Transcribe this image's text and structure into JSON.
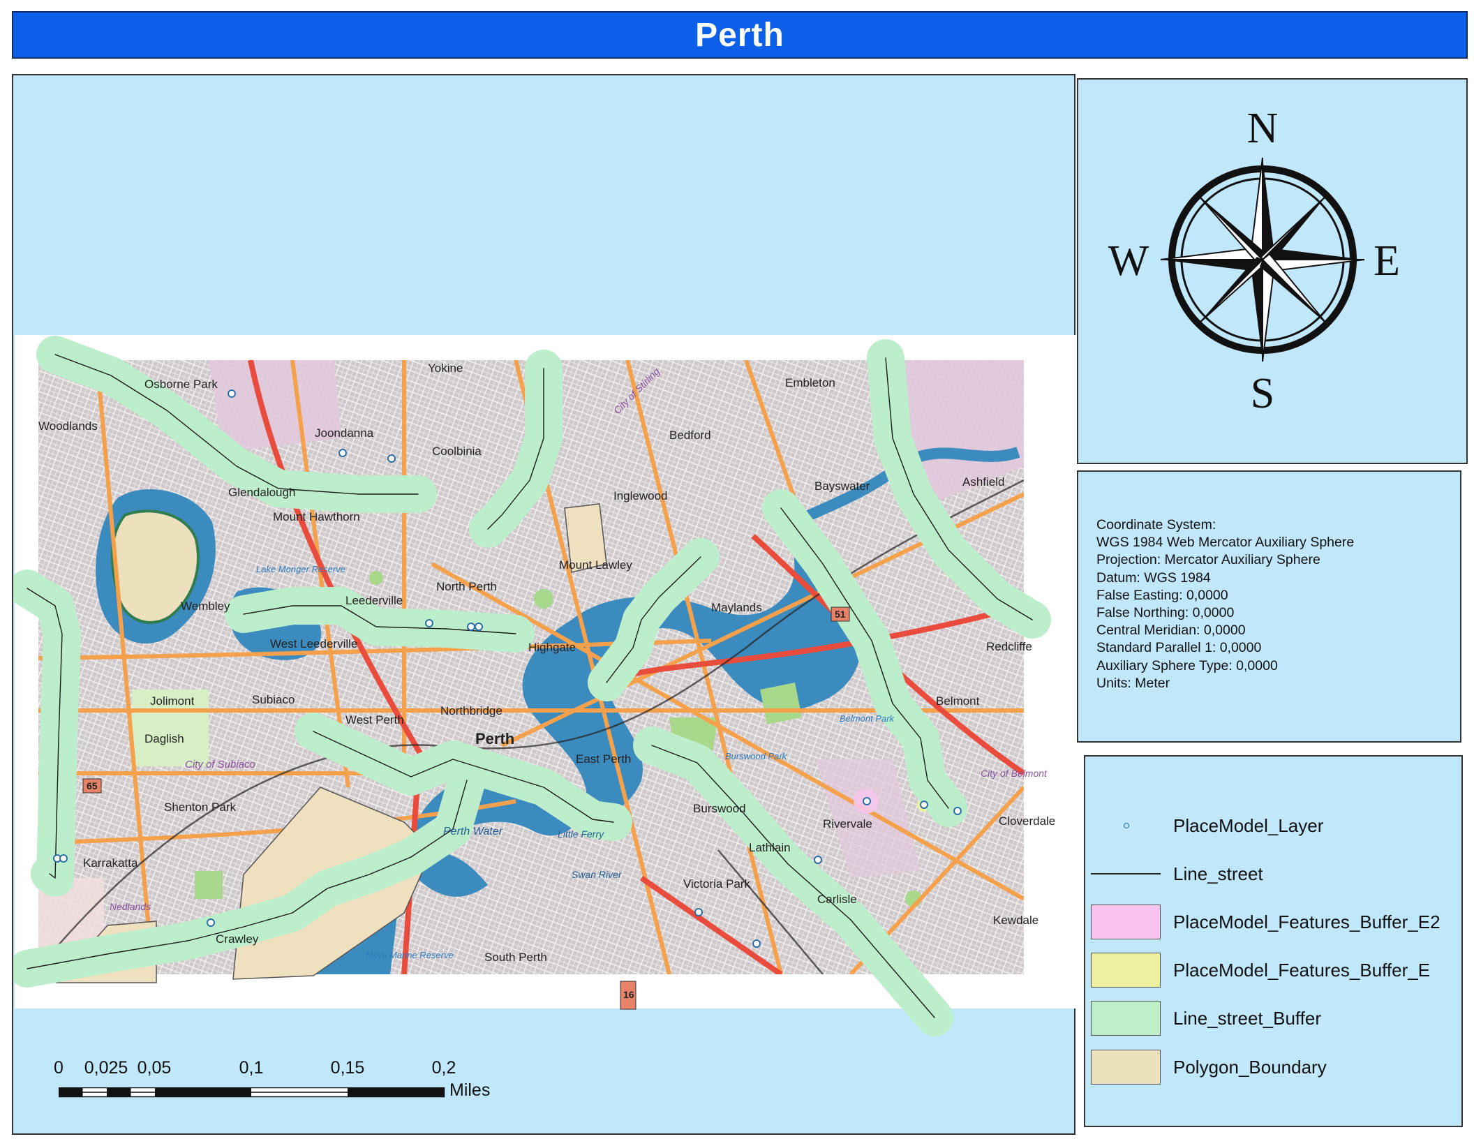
{
  "title": "Perth",
  "map": {
    "place_names": [
      "Osborne Park",
      "Yokine",
      "Embleton",
      "Woodlands",
      "Joondanna",
      "Coolbinia",
      "Bedford",
      "Ashfield",
      "Glendalough",
      "Mount Hawthorn",
      "Inglewood",
      "Bayswater",
      "Mount Lawley",
      "Lake Monger Reserve",
      "Leederville",
      "North Perth",
      "Maylands",
      "Wembley",
      "West Leederville",
      "Highgate",
      "Redcliffe",
      "Jolimont",
      "Subiaco",
      "West Perth",
      "Northbridge",
      "Belmont",
      "Daglish",
      "Perth",
      "East Perth",
      "City of Subiaco",
      "Shenton Park",
      "Perth Water",
      "Burswood",
      "Rivervale",
      "Cloverdale",
      "Karrakatta",
      "Victoria Park",
      "Lathlain",
      "Carlisle",
      "Kewdale",
      "Nedlands",
      "Crawley",
      "South Perth",
      "Milyu Marine Reserve",
      "Swan River",
      "Little Ferry",
      "City of Stirling",
      "City of Belmont",
      "Belmont Park",
      "Burswood Park"
    ],
    "road_shields": [
      "51",
      "65",
      "16"
    ],
    "colors": {
      "water": "#3c8bbf",
      "street_buffer": "#bdeecb",
      "polygon": "#efe1bf",
      "feature_buffer_e2": "#f5b9e6",
      "feature_buffer_e": "#f0f09e",
      "frame_bg": "#c1e7fb"
    }
  },
  "north_arrow": {
    "n": "N",
    "s": "S",
    "e": "E",
    "w": "W"
  },
  "coordinate_system": [
    "Coordinate System:",
    "WGS 1984 Web Mercator Auxiliary Sphere",
    "Projection: Mercator Auxiliary Sphere",
    "Datum: WGS 1984",
    "False Easting: 0,0000",
    "False Northing: 0,0000",
    "Central Meridian: 0,0000",
    "Standard Parallel 1: 0,0000",
    "Auxiliary Sphere Type: 0,0000",
    "Units: Meter"
  ],
  "legend": {
    "items": [
      {
        "label": "PlaceModel_Layer",
        "symbol": "point",
        "color": "#2a6ea8"
      },
      {
        "label": "Line_street",
        "symbol": "line",
        "color": "#222222"
      },
      {
        "label": "PlaceModel_Features_Buffer_E2",
        "symbol": "fill",
        "color": "#f8c4ef"
      },
      {
        "label": "PlaceModel_Features_Buffer_E",
        "symbol": "fill",
        "color": "#eef09e"
      },
      {
        "label": "Line_street_Buffer",
        "symbol": "fill",
        "color": "#bdefc9"
      },
      {
        "label": "Polygon_Boundary",
        "symbol": "fill",
        "color": "#ede0bc"
      }
    ]
  },
  "scalebar": {
    "labels": [
      "0",
      "0,025",
      "0,05",
      "0,1",
      "0,15",
      "0,2"
    ],
    "values": [
      0,
      0.025,
      0.05,
      0.1,
      0.15,
      0.2
    ],
    "units": "Miles"
  }
}
